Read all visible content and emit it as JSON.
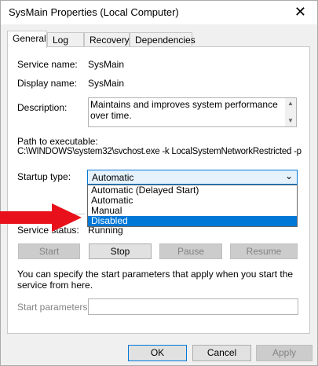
{
  "window": {
    "title": "SysMain Properties (Local Computer)",
    "close_glyph": "✕"
  },
  "tabs": [
    {
      "label": "General"
    },
    {
      "label": "Log On"
    },
    {
      "label": "Recovery"
    },
    {
      "label": "Dependencies"
    }
  ],
  "general": {
    "service_name_label": "Service name:",
    "service_name": "SysMain",
    "display_name_label": "Display name:",
    "display_name": "SysMain",
    "description_label": "Description:",
    "description": "Maintains and improves system performance over time.",
    "path_label": "Path to executable:",
    "path": "C:\\WINDOWS\\system32\\svchost.exe -k LocalSystemNetworkRestricted -p",
    "startup_type_label": "Startup type:",
    "startup_type_value": "Automatic",
    "startup_options": [
      "Automatic (Delayed Start)",
      "Automatic",
      "Manual",
      "Disabled"
    ],
    "highlighted_option": "Disabled",
    "service_status_label": "Service status:",
    "service_status": "Running",
    "buttons": {
      "start": "Start",
      "stop": "Stop",
      "pause": "Pause",
      "resume": "Resume"
    },
    "hint": "You can specify the start parameters that apply when you start the service from here.",
    "start_params_label": "Start parameters:",
    "start_params_value": ""
  },
  "footer": {
    "ok": "OK",
    "cancel": "Cancel",
    "apply": "Apply"
  },
  "colors": {
    "accent": "#0078d7",
    "annotation_arrow": "#e8101a"
  }
}
